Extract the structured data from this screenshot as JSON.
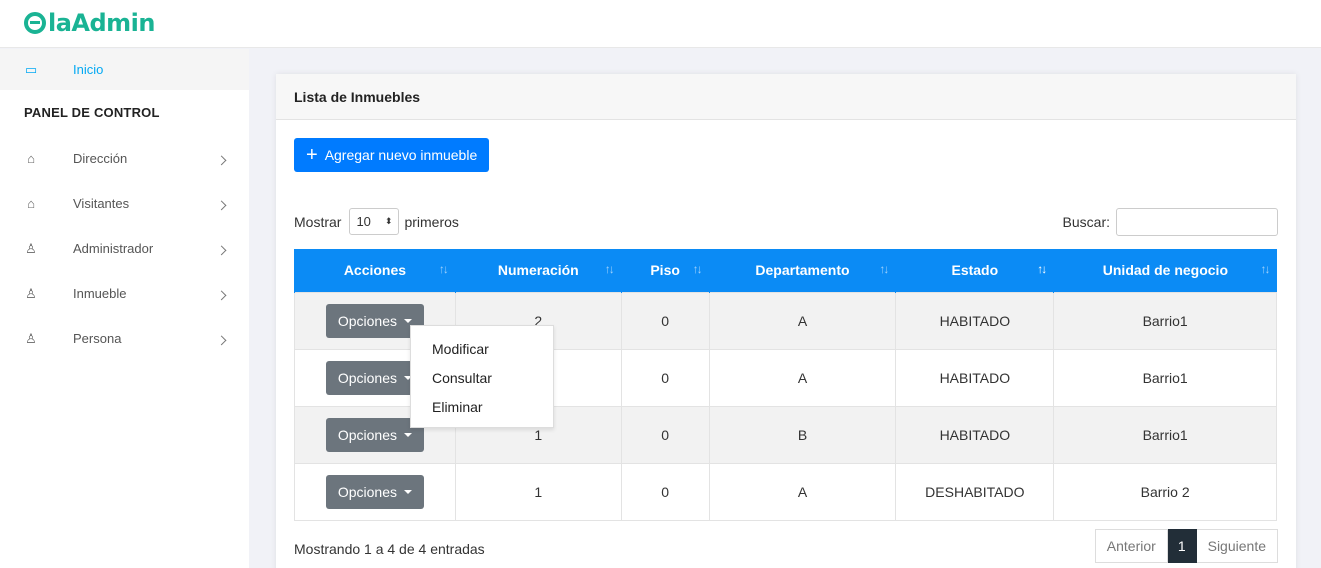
{
  "brand": {
    "logo_text": "laAdmin",
    "accent": "#1ab394"
  },
  "sidebar": {
    "home": {
      "label": "Inicio",
      "icon": "laptop-icon"
    },
    "section_title": "PANEL DE CONTROL",
    "items": [
      {
        "label": "Dirección",
        "icon": "building-icon"
      },
      {
        "label": "Visitantes",
        "icon": "home-icon"
      },
      {
        "label": "Administrador",
        "icon": "user-icon"
      },
      {
        "label": "Inmueble",
        "icon": "user-icon"
      },
      {
        "label": "Persona",
        "icon": "user-icon"
      }
    ]
  },
  "card": {
    "title": "Lista de Inmuebles",
    "add_button": {
      "icon": "plus-icon",
      "label": "Agregar nuevo inmueble"
    },
    "length": {
      "prefix": "Mostrar",
      "value": "10",
      "suffix": "primeros"
    },
    "search": {
      "label": "Buscar:",
      "value": ""
    },
    "table": {
      "header_color": "#0b8bf5",
      "columns": [
        "Acciones",
        "Numeración",
        "Piso",
        "Departamento",
        "Estado",
        "Unidad de negocio"
      ],
      "rows": [
        {
          "action": "Opciones",
          "numeracion": "2",
          "piso": "0",
          "departamento": "A",
          "estado": "HABITADO",
          "unidad": "Barrio1"
        },
        {
          "action": "Opciones",
          "numeracion": "",
          "piso": "0",
          "departamento": "A",
          "estado": "HABITADO",
          "unidad": "Barrio1"
        },
        {
          "action": "Opciones",
          "numeracion": "1",
          "piso": "0",
          "departamento": "B",
          "estado": "HABITADO",
          "unidad": "Barrio1"
        },
        {
          "action": "Opciones",
          "numeracion": "1",
          "piso": "0",
          "departamento": "A",
          "estado": "DESHABITADO",
          "unidad": "Barrio 2"
        }
      ]
    },
    "dropdown": {
      "items": [
        "Modificar",
        "Consultar",
        "Eliminar"
      ]
    },
    "info": "Mostrando 1 a 4 de 4 entradas",
    "pagination": {
      "prev": "Anterior",
      "current": "1",
      "next": "Siguiente"
    }
  }
}
